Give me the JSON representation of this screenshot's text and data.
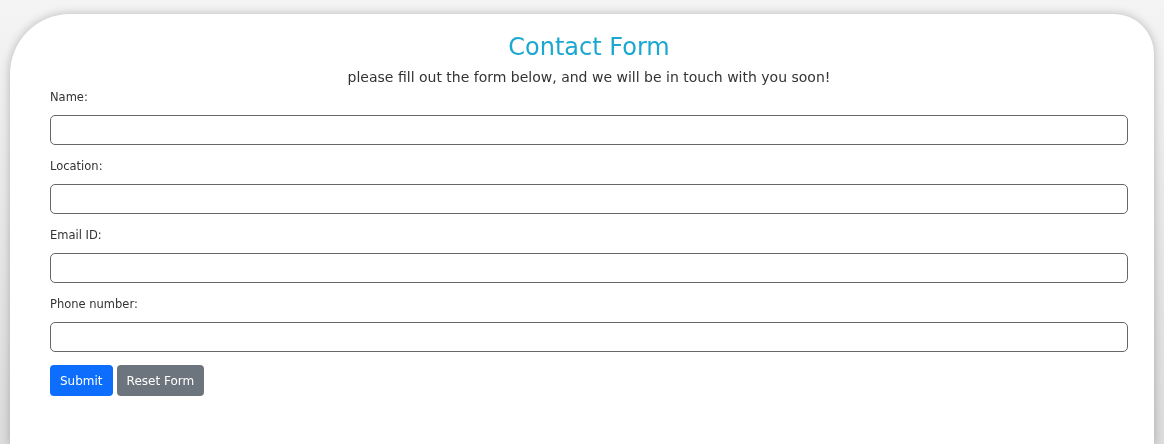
{
  "title": "Contact Form",
  "subtitle": "please fill out the form below, and we will be in touch with you soon!",
  "fields": [
    {
      "label": "Name:"
    },
    {
      "label": "Location:"
    },
    {
      "label": "Email ID:"
    },
    {
      "label": "Phone number:"
    }
  ],
  "buttons": [
    {
      "label": "Submit",
      "kind": "primary"
    },
    {
      "label": "Reset Form",
      "kind": "secondary"
    }
  ]
}
